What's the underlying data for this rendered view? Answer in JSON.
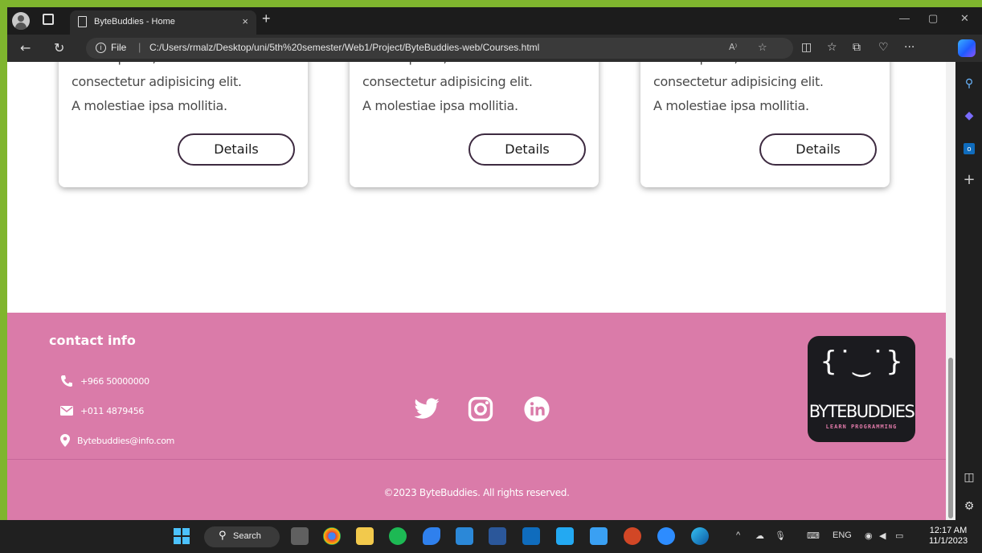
{
  "browser": {
    "tab_title": "ByteBuddies - Home",
    "tab_close": "×",
    "new_tab": "+",
    "window_controls": {
      "minimize": "—",
      "maximize": "▢",
      "close": "✕"
    },
    "url_scheme_label": "File",
    "url_separator": "|",
    "url": "C:/Users/rmalz/Desktop/uni/5th%20semester/Web1/Project/ByteBuddies-web/Courses.html",
    "read_aloud_icon": "A⁾",
    "more_label": "···"
  },
  "cards": [
    {
      "lines": [
        "Lorem ipsum, dolor sit amet",
        "consectetur adipisicing elit.",
        "A molestiae ipsa mollitia."
      ],
      "button": "Details"
    },
    {
      "lines": [
        "Lorem ipsum, dolor sit amet",
        "consectetur adipisicing elit.",
        "A molestiae ipsa mollitia."
      ],
      "button": "Details"
    },
    {
      "lines": [
        "Lorem ipsum, dolor sit amet",
        "consectetur adipisicing elit.",
        "A molestiae ipsa mollitia."
      ],
      "button": "Details"
    }
  ],
  "footer": {
    "contact_title": "contact info",
    "phone": "+966 50000000",
    "fax": "+011 4879456",
    "email": "Bytebuddies@info.com",
    "social": [
      "twitter",
      "instagram",
      "linkedin"
    ],
    "logo": {
      "face": "{˙‿˙}",
      "name": "BYTEBUDDIES",
      "tagline": "LEARN PROGRAMMING"
    },
    "copyright": "©2023 ByteBuddies. All rights reserved."
  },
  "taskbar": {
    "search_label": "Search",
    "language": "ENG",
    "time": "12:17 AM",
    "date": "11/1/2023"
  },
  "colors": {
    "footer_bg": "#da7ba9",
    "outer_border": "#7fb52e",
    "logo_bg": "#1b1b1f",
    "logo_accent": "#e07aa9"
  }
}
